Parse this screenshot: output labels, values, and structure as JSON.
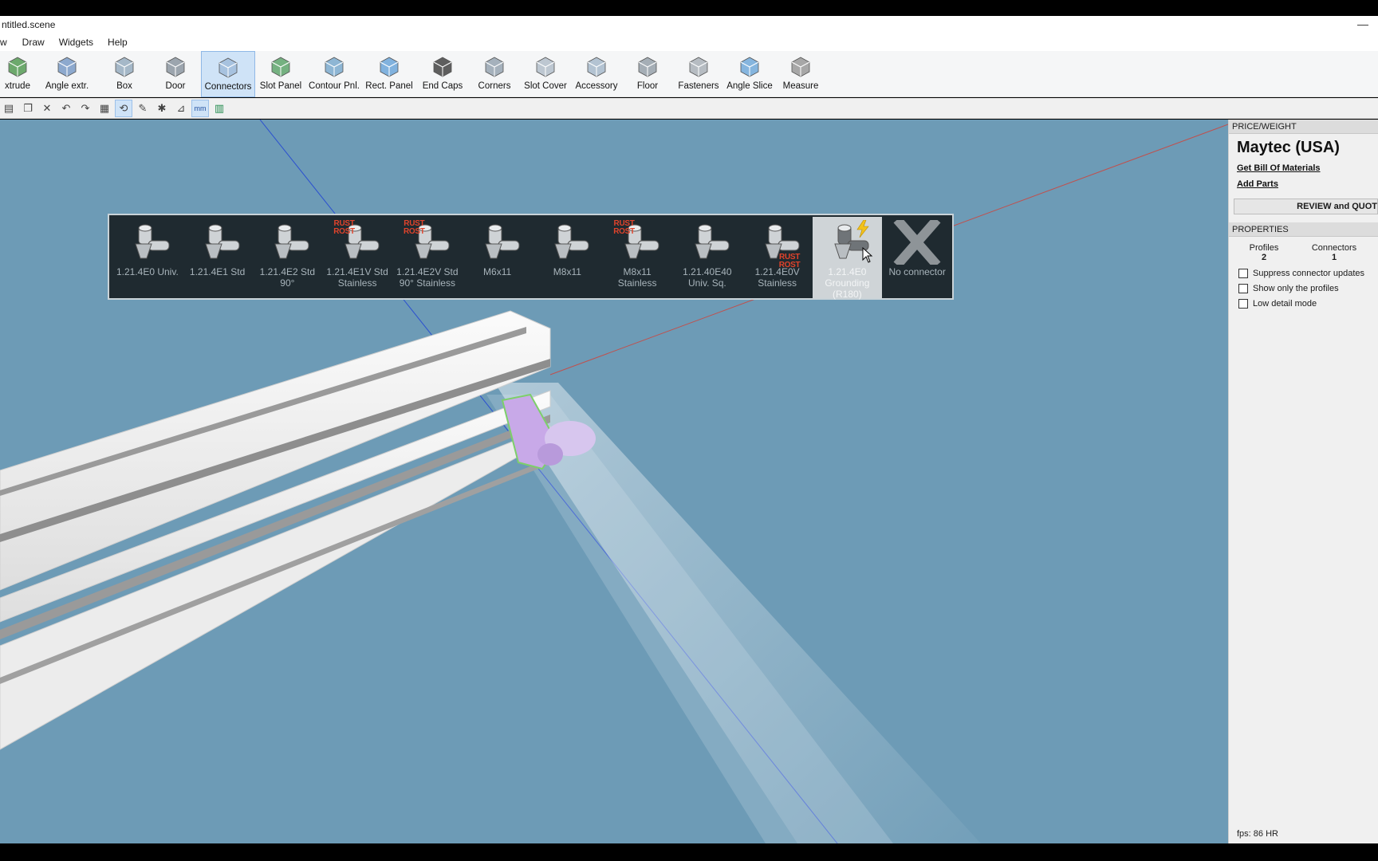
{
  "window": {
    "title": "ntitled.scene",
    "minimize_label": "—"
  },
  "menu": {
    "items": [
      "w",
      "Draw",
      "Widgets",
      "Help"
    ]
  },
  "ribbon": {
    "tools": [
      {
        "label": "xtrude",
        "icon": "extrude-icon"
      },
      {
        "label": "Angle extr.",
        "icon": "angle-extrude-icon"
      },
      {
        "label": "Box",
        "icon": "box-icon"
      },
      {
        "label": "Door",
        "icon": "door-icon"
      },
      {
        "label": "Connectors",
        "icon": "connectors-icon",
        "active": true
      },
      {
        "label": "Slot Panel",
        "icon": "slot-panel-icon"
      },
      {
        "label": "Contour Pnl.",
        "icon": "contour-panel-icon"
      },
      {
        "label": "Rect. Panel",
        "icon": "rect-panel-icon"
      },
      {
        "label": "End Caps",
        "icon": "end-caps-icon"
      },
      {
        "label": "Corners",
        "icon": "corners-icon"
      },
      {
        "label": "Slot Cover",
        "icon": "slot-cover-icon"
      },
      {
        "label": "Accessory",
        "icon": "accessory-icon"
      },
      {
        "label": "Floor",
        "icon": "floor-icon"
      },
      {
        "label": "Fasteners",
        "icon": "fasteners-icon"
      },
      {
        "label": "Angle Slice",
        "icon": "angle-slice-icon"
      },
      {
        "label": "Measure",
        "icon": "measure-icon"
      }
    ]
  },
  "toolbar2": {
    "buttons": [
      "paste-icon",
      "copy-icon",
      "delete-icon",
      "undo-icon",
      "redo-icon",
      "grid-icon",
      "rotate-icon",
      "edit-icon",
      "bug-icon",
      "measure-angle-icon",
      "units-mm-icon",
      "color-icon"
    ],
    "units_label": "mm"
  },
  "connectors": {
    "items": [
      {
        "name": "1.21.4E0 Univ.",
        "rust": false
      },
      {
        "name": "1.21.4E1 Std",
        "rust": false
      },
      {
        "name": "1.21.4E2 Std\n90°",
        "rust": false
      },
      {
        "name": "1.21.4E1V Std\nStainless",
        "rust": true
      },
      {
        "name": "1.21.4E2V Std\n90° Stainless",
        "rust": true
      },
      {
        "name": "M6x11",
        "rust": false
      },
      {
        "name": "M8x11",
        "rust": false
      },
      {
        "name": "M8x11\nStainless",
        "rust": true
      },
      {
        "name": "1.21.40E40\nUniv. Sq.",
        "rust": false
      },
      {
        "name": "1.21.4E0V\nStainless",
        "rust": true
      },
      {
        "name": "1.21.4E0\nGrounding\n(R180)",
        "rust": false,
        "selected": true,
        "grounding": true
      },
      {
        "name": "No connector",
        "rust": false,
        "none": true
      }
    ],
    "rust_text_1": "RUST",
    "rust_text_2": "ROST"
  },
  "sidebar": {
    "price_header": "PRICE/WEIGHT",
    "brand": "Maytec (USA)",
    "bom_link": "Get Bill Of Materials",
    "add_parts_link": "Add Parts",
    "review_button": "REVIEW and QUOT",
    "properties_header": "PROPERTIES",
    "profiles_label": "Profiles",
    "profiles_value": "2",
    "connectors_label": "Connectors",
    "connectors_value": "1",
    "options": [
      {
        "label": "Suppress connector updates",
        "checked": false
      },
      {
        "label": "Show only the profiles",
        "checked": false
      },
      {
        "label": "Low detail mode",
        "checked": false
      }
    ],
    "fps": "fps: 86 HR"
  },
  "colors": {
    "viewport_bg": "#6d9bb6",
    "popup_bg": "#1f2a30",
    "selection_purple": "#c8a9e8",
    "rust_red": "#e0432b",
    "ribbon_active": "#cfe3f7"
  }
}
